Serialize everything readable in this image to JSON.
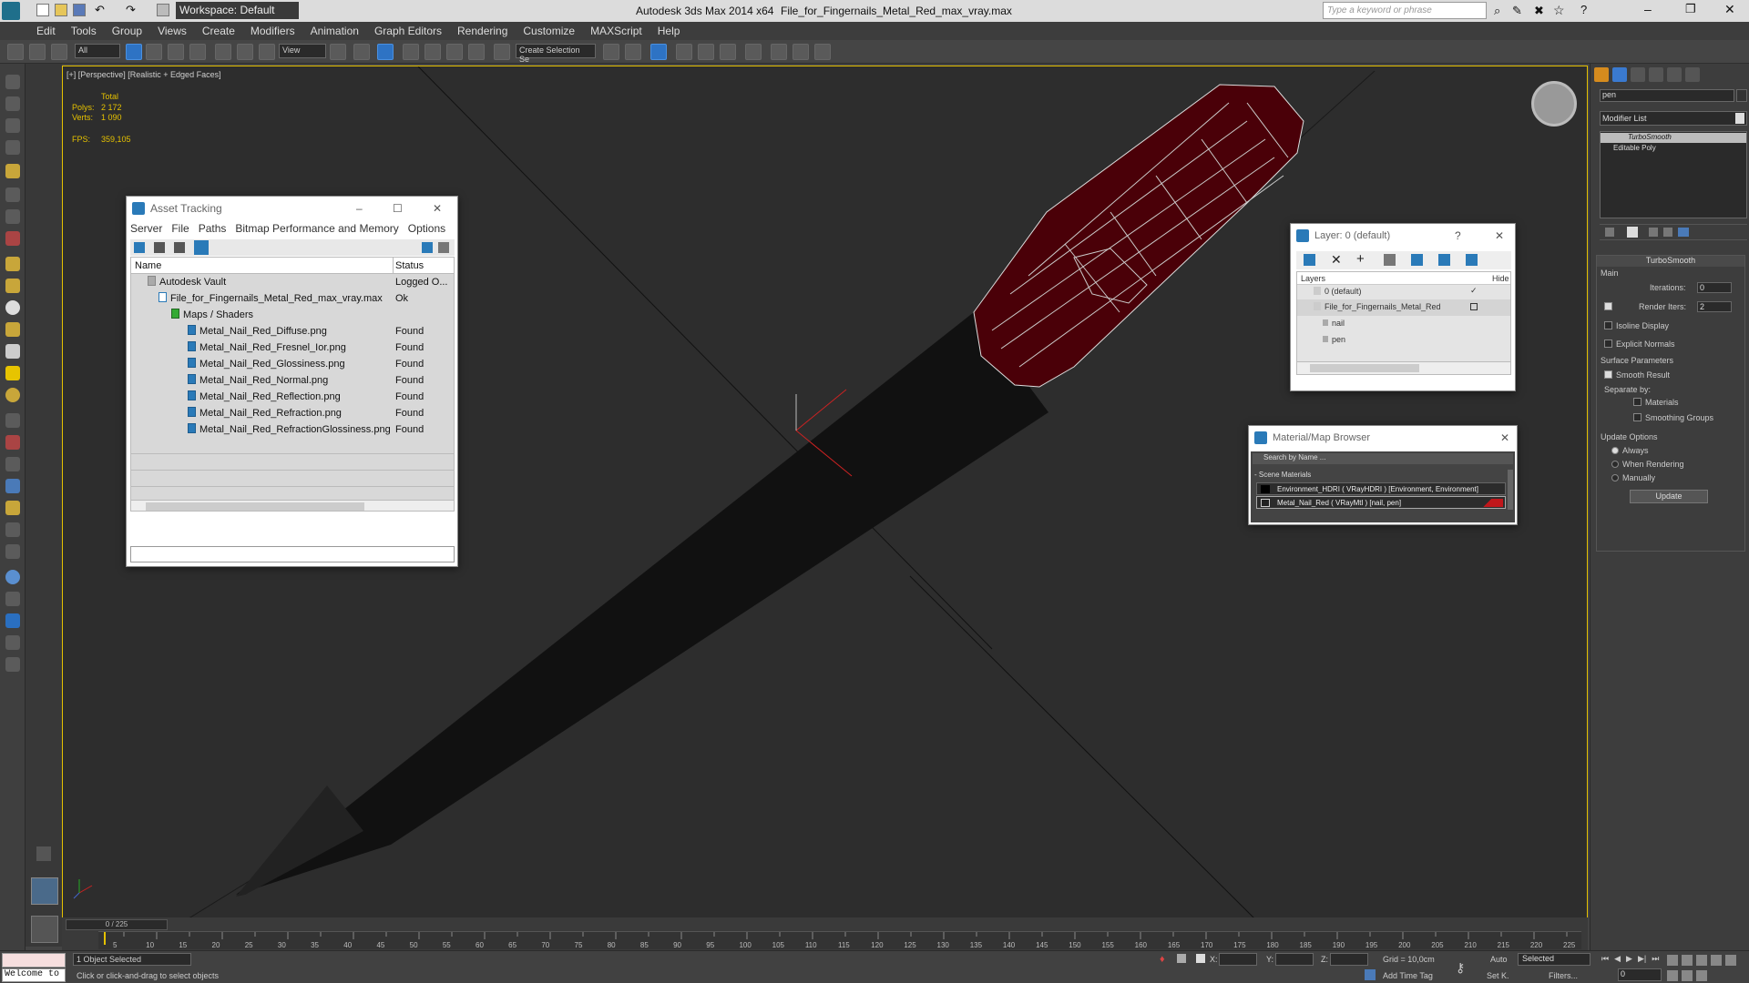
{
  "titlebar": {
    "workspace_label": "Workspace: Default",
    "app_title": "Autodesk 3ds Max  2014 x64",
    "file_title": "File_for_Fingernails_Metal_Red_max_vray.max",
    "search_placeholder": "Type a keyword or phrase"
  },
  "menu": [
    "Edit",
    "Tools",
    "Group",
    "Views",
    "Create",
    "Modifiers",
    "Animation",
    "Graph Editors",
    "Rendering",
    "Customize",
    "MAXScript",
    "Help"
  ],
  "toolbar": {
    "selection_filter": "All",
    "ref_coord": "View",
    "named_selection_placeholder": "Create Selection Se"
  },
  "viewport": {
    "label": "[+] [Perspective] [Realistic + Edged Faces]",
    "stats": {
      "total_label": "Total",
      "polys_label": "Polys:",
      "polys_value": "2 172",
      "verts_label": "Verts:",
      "verts_value": "1 090",
      "fps_label": "FPS:",
      "fps_value": "359,105"
    }
  },
  "asset_tracking": {
    "title": "Asset Tracking",
    "menu": [
      "Server",
      "File",
      "Paths",
      "Bitmap Performance and Memory",
      "Options"
    ],
    "columns": {
      "name": "Name",
      "status": "Status"
    },
    "rows": [
      {
        "name": "Autodesk Vault",
        "status": "Logged O..."
      },
      {
        "name": "File_for_Fingernails_Metal_Red_max_vray.max",
        "status": "Ok"
      },
      {
        "name": "Maps / Shaders",
        "status": ""
      },
      {
        "name": "Metal_Nail_Red_Diffuse.png",
        "status": "Found"
      },
      {
        "name": "Metal_Nail_Red_Fresnel_Ior.png",
        "status": "Found"
      },
      {
        "name": "Metal_Nail_Red_Glossiness.png",
        "status": "Found"
      },
      {
        "name": "Metal_Nail_Red_Normal.png",
        "status": "Found"
      },
      {
        "name": "Metal_Nail_Red_Reflection.png",
        "status": "Found"
      },
      {
        "name": "Metal_Nail_Red_Refraction.png",
        "status": "Found"
      },
      {
        "name": "Metal_Nail_Red_RefractionGlossiness.png",
        "status": "Found"
      }
    ]
  },
  "layer_window": {
    "title": "Layer: 0 (default)",
    "columns": {
      "layers": "Layers",
      "hide": "Hide"
    },
    "rows": [
      {
        "name": "0 (default)"
      },
      {
        "name": "File_for_Fingernails_Metal_Red"
      },
      {
        "name": "nail"
      },
      {
        "name": "pen"
      }
    ]
  },
  "material_browser": {
    "title": "Material/Map Browser",
    "search_placeholder": "Search by Name ...",
    "section": "- Scene Materials",
    "items": [
      {
        "name": "Environment_HDRI  ( VRayHDRI ) [Environment, Environment]"
      },
      {
        "name": "Metal_Nail_Red  ( VRayMtl ) [nail, pen]"
      }
    ]
  },
  "command_panel": {
    "search_value": "pen",
    "modifier_list": "Modifier List",
    "stack": [
      "TurboSmooth",
      "Editable Poly"
    ],
    "rollout_title": "TurboSmooth",
    "main_label": "Main",
    "iterations_label": "Iterations:",
    "iterations_value": "0",
    "render_iters_label": "Render Iters:",
    "render_iters_value": "2",
    "isoline_label": "Isoline Display",
    "explicit_normals_label": "Explicit Normals",
    "surface_params_label": "Surface Parameters",
    "smooth_result_label": "Smooth Result",
    "separate_by_label": "Separate by:",
    "materials_label": "Materials",
    "smoothing_groups_label": "Smoothing Groups",
    "update_options_label": "Update Options",
    "always_label": "Always",
    "when_rendering_label": "When Rendering",
    "manually_label": "Manually",
    "update_button": "Update"
  },
  "timeline": {
    "frame_counter": "0 / 225",
    "ticks": [
      "5",
      "10",
      "15",
      "20",
      "25",
      "30",
      "35",
      "40",
      "45",
      "50",
      "55",
      "60",
      "65",
      "70",
      "75",
      "80",
      "85",
      "90",
      "95",
      "100",
      "105",
      "110",
      "115",
      "120",
      "125",
      "130",
      "135",
      "140",
      "145",
      "150",
      "155",
      "160",
      "165",
      "170",
      "175",
      "180",
      "185",
      "190",
      "195",
      "200",
      "205",
      "210",
      "215",
      "220",
      "225"
    ]
  },
  "status": {
    "listener": "Welcome to",
    "selection": "1 Object Selected",
    "prompt": "Click or click-and-drag to select objects",
    "x_label": "X:",
    "y_label": "Y:",
    "z_label": "Z:",
    "grid": "Grid = 10,0cm",
    "add_time_tag": "Add Time Tag",
    "auto": "Auto",
    "set_key": "Set K.",
    "selected": "Selected",
    "filters": "Filters...",
    "frame": "0"
  }
}
